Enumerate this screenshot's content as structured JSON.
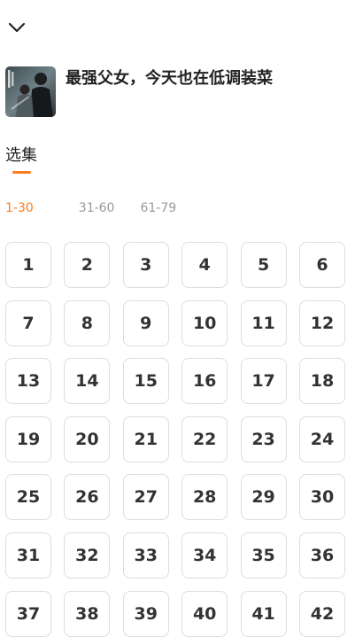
{
  "show": {
    "title": "最强父女，今天也在低调装菜"
  },
  "episodes_section": {
    "title": "选集",
    "accent_color": "#ff7a1a",
    "ranges": [
      {
        "label": "1-30",
        "active": true
      },
      {
        "label": "31-60",
        "active": false
      },
      {
        "label": "61-79",
        "active": false
      }
    ],
    "episodes": [
      "1",
      "2",
      "3",
      "4",
      "5",
      "6",
      "7",
      "8",
      "9",
      "10",
      "11",
      "12",
      "13",
      "14",
      "15",
      "16",
      "17",
      "18",
      "19",
      "20",
      "21",
      "22",
      "23",
      "24",
      "25",
      "26",
      "27",
      "28",
      "29",
      "30",
      "31",
      "32",
      "33",
      "34",
      "35",
      "36",
      "37",
      "38",
      "39",
      "40",
      "41",
      "42"
    ]
  },
  "icons": {
    "collapse": "chevron-down-icon"
  }
}
